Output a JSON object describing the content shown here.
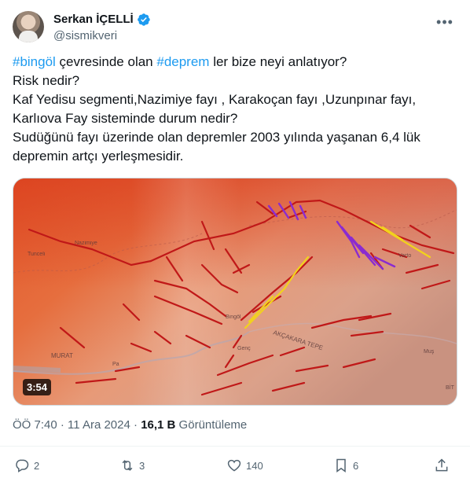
{
  "author": {
    "name": "Serkan İÇELLİ",
    "handle": "@sismikveri"
  },
  "tweet": {
    "lines": [
      [
        {
          "text": "#bingöl",
          "type": "hashtag"
        },
        {
          "text": " çevresinde olan ",
          "type": "text"
        },
        {
          "text": "#deprem",
          "type": "hashtag"
        },
        {
          "text": " ler bize neyi anlatıyor?",
          "type": "text"
        }
      ],
      [
        {
          "text": "Risk nedir?",
          "type": "text"
        }
      ],
      [
        {
          "text": "Kaf Yedisu segmenti,Nazimiye fayı , Karakoçan fayı ,Uzunpınar fayı,",
          "type": "text"
        }
      ],
      [
        {
          "text": "Karlıova Fay sisteminde durum nedir?",
          "type": "text"
        }
      ],
      [
        {
          "text": "Sudüğünü fayı üzerinde olan depremler 2003 yılında yaşanan  6,4 lük",
          "type": "text"
        }
      ],
      [
        {
          "text": "depremin artçı yerleşmesidir.",
          "type": "text"
        }
      ]
    ]
  },
  "media": {
    "duration": "3:54",
    "map_labels": [
      "Nazimiye",
      "Tunceli",
      "Varto",
      "Bingöl",
      "Genç",
      "AKÇAKARA TEPE",
      "MURAT",
      "Pa",
      "Muş",
      "BİT"
    ]
  },
  "meta": {
    "time": "ÖÖ 7:40",
    "sep1": " · ",
    "date": "11 Ara 2024",
    "sep2": " · ",
    "views": "16,1 B",
    "views_label": " Görüntüleme"
  },
  "actions": {
    "replies": "2",
    "reposts": "3",
    "likes": "140",
    "bookmarks": "6"
  },
  "colors": {
    "hashtag": "#1d9bf0",
    "muted": "#536471",
    "fault_red": "#c01818",
    "fault_purple": "#8a2bd0",
    "fault_yellow": "#f2d21c"
  }
}
